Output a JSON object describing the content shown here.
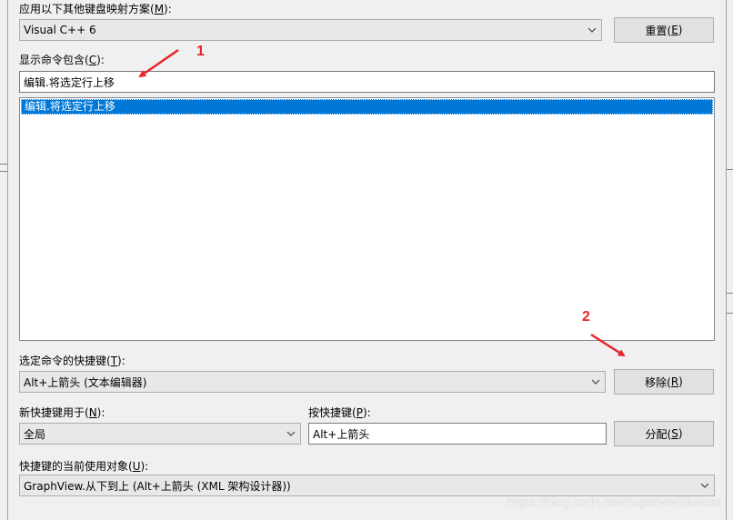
{
  "mapping_scheme": {
    "label_text": "应用以下其他键盘映射方案(",
    "label_key": "M",
    "label_tail": "):",
    "selected": "Visual C++ 6",
    "reset_text": "重置(",
    "reset_key": "E",
    "reset_tail": ")"
  },
  "show_commands": {
    "label_text": "显示命令包含(",
    "label_key": "C",
    "label_tail": "):",
    "value": "编辑.将选定行上移",
    "list_items": [
      "编辑.将选定行上移"
    ]
  },
  "selected_command_shortcuts": {
    "label_text": "选定命令的快捷键(",
    "label_key": "T",
    "label_tail": "):",
    "selected": "Alt+上箭头 (文本编辑器)",
    "remove_text": "移除(",
    "remove_key": "R",
    "remove_tail": ")"
  },
  "use_new_shortcut_in": {
    "label_text": "新快捷键用于(",
    "label_key": "N",
    "label_tail": "):",
    "selected": "全局"
  },
  "press_shortcut": {
    "label_text": "按快捷键(",
    "label_key": "P",
    "label_tail": "):",
    "value": "Alt+上箭头",
    "assign_text": "分配(",
    "assign_key": "S",
    "assign_tail": ")"
  },
  "shortcut_currently_used_by": {
    "label_text": "快捷键的当前使用对象(",
    "label_key": "U",
    "label_tail": "):",
    "selected": "GraphView.从下到上 (Alt+上箭头 (XML 架构设计器))"
  },
  "annotations": {
    "marker_1": "1",
    "marker_2": "2",
    "color": "#e8232a"
  },
  "watermark": "https://blog.csdn.net/SuperweiBluecat",
  "icons": {
    "dropdown": "chevron-down-icon"
  }
}
